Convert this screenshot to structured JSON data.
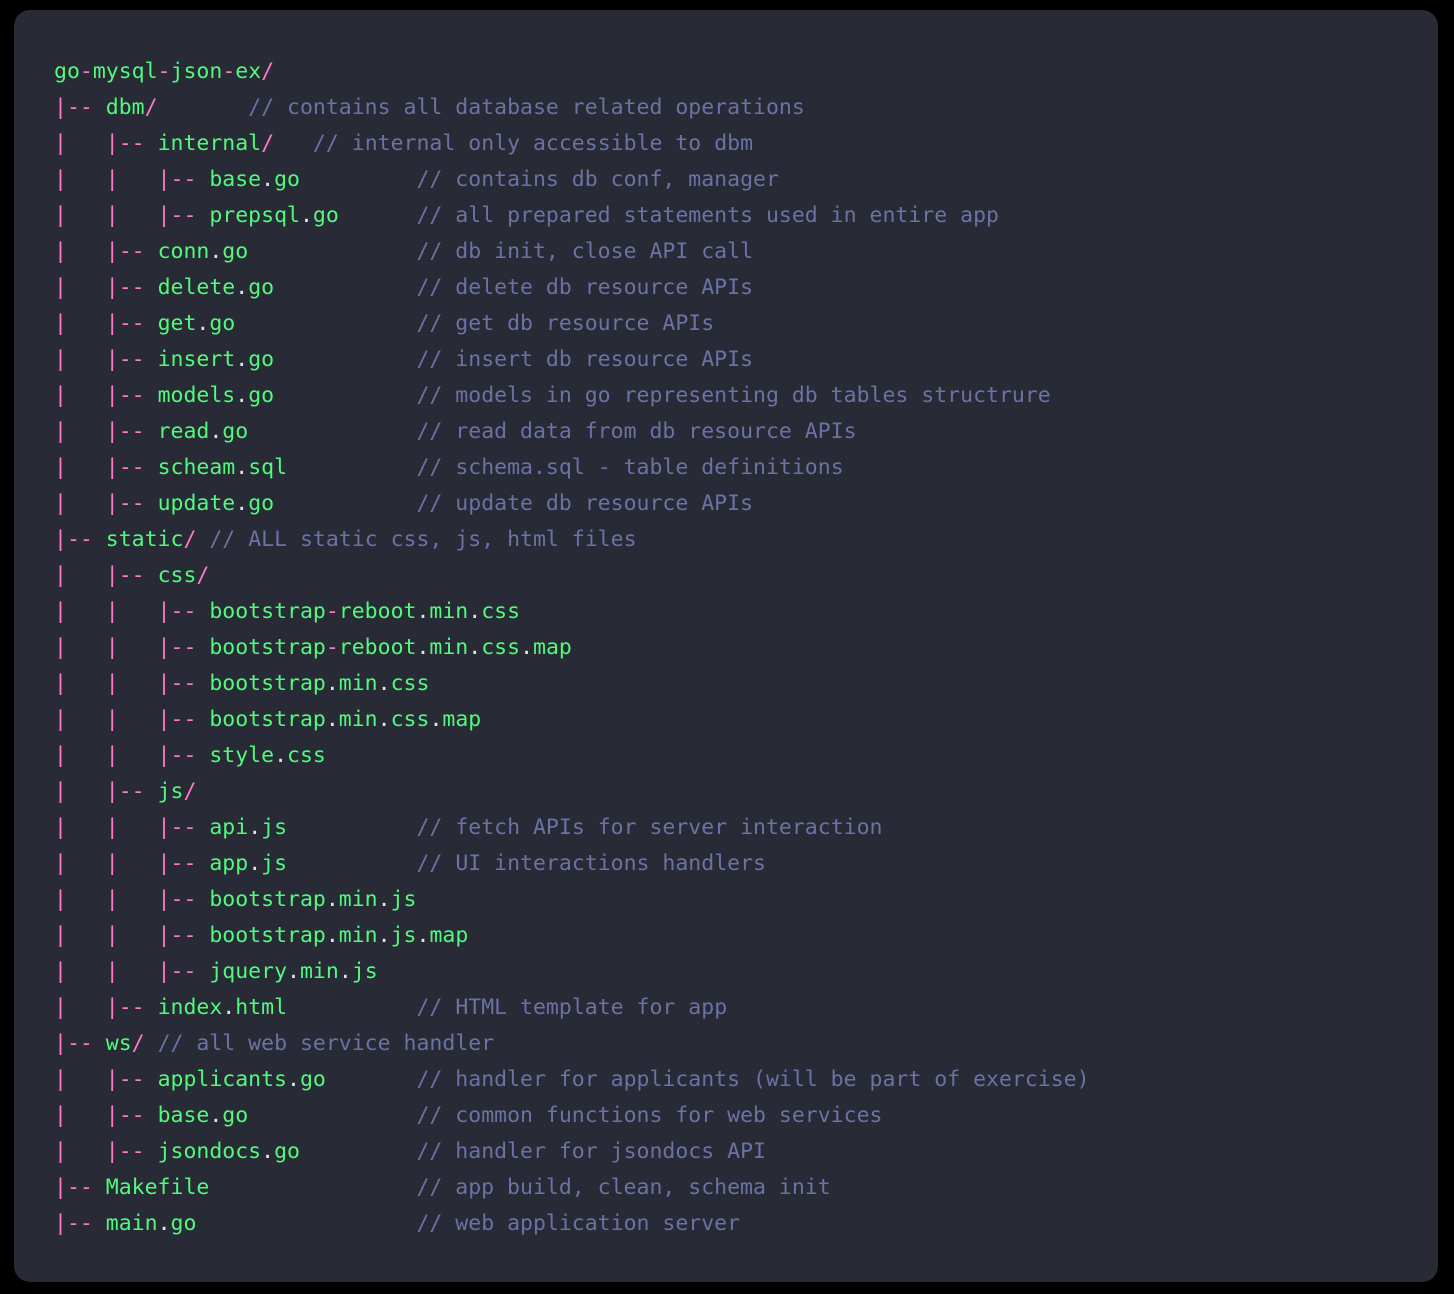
{
  "theme": {
    "outer_background": "#000000",
    "panel_background": "#282a36",
    "tree_color": "#ff79c6",
    "name_color": "#50fa7b",
    "dot_color": "#e2e2ea",
    "comment_color": "#6b72a4"
  },
  "tree": {
    "root": "go-mysql-json-ex/",
    "lines": [
      {
        "prefix": "",
        "name": "go-mysql-json-ex/",
        "pad": 0,
        "comment": ""
      },
      {
        "prefix": "|-- ",
        "name": "dbm/",
        "pad": 7,
        "comment": "// contains all database related operations"
      },
      {
        "prefix": "|   |-- ",
        "name": "internal/",
        "pad": 3,
        "comment": "// internal only accessible to dbm"
      },
      {
        "prefix": "|   |   |-- ",
        "name": "base.go",
        "pad": 9,
        "comment": "// contains db conf, manager"
      },
      {
        "prefix": "|   |   |-- ",
        "name": "prepsql.go",
        "pad": 6,
        "comment": "// all prepared statements used in entire app"
      },
      {
        "prefix": "|   |-- ",
        "name": "conn.go",
        "pad": 13,
        "comment": "// db init, close API call"
      },
      {
        "prefix": "|   |-- ",
        "name": "delete.go",
        "pad": 11,
        "comment": "// delete db resource APIs"
      },
      {
        "prefix": "|   |-- ",
        "name": "get.go",
        "pad": 14,
        "comment": "// get db resource APIs"
      },
      {
        "prefix": "|   |-- ",
        "name": "insert.go",
        "pad": 11,
        "comment": "// insert db resource APIs"
      },
      {
        "prefix": "|   |-- ",
        "name": "models.go",
        "pad": 11,
        "comment": "// models in go representing db tables structrure"
      },
      {
        "prefix": "|   |-- ",
        "name": "read.go",
        "pad": 13,
        "comment": "// read data from db resource APIs"
      },
      {
        "prefix": "|   |-- ",
        "name": "scheam.sql",
        "pad": 10,
        "comment": "// schema.sql - table definitions"
      },
      {
        "prefix": "|   |-- ",
        "name": "update.go",
        "pad": 11,
        "comment": "// update db resource APIs"
      },
      {
        "prefix": "|-- ",
        "name": "static/",
        "pad": 1,
        "comment": "// ALL static css, js, html files"
      },
      {
        "prefix": "|   |-- ",
        "name": "css/",
        "pad": 0,
        "comment": ""
      },
      {
        "prefix": "|   |   |-- ",
        "name": "bootstrap-reboot.min.css",
        "pad": 0,
        "comment": ""
      },
      {
        "prefix": "|   |   |-- ",
        "name": "bootstrap-reboot.min.css.map",
        "pad": 0,
        "comment": ""
      },
      {
        "prefix": "|   |   |-- ",
        "name": "bootstrap.min.css",
        "pad": 0,
        "comment": ""
      },
      {
        "prefix": "|   |   |-- ",
        "name": "bootstrap.min.css.map",
        "pad": 0,
        "comment": ""
      },
      {
        "prefix": "|   |   |-- ",
        "name": "style.css",
        "pad": 0,
        "comment": ""
      },
      {
        "prefix": "|   |-- ",
        "name": "js/",
        "pad": 0,
        "comment": ""
      },
      {
        "prefix": "|   |   |-- ",
        "name": "api.js",
        "pad": 10,
        "comment": "// fetch APIs for server interaction"
      },
      {
        "prefix": "|   |   |-- ",
        "name": "app.js",
        "pad": 10,
        "comment": "// UI interactions handlers"
      },
      {
        "prefix": "|   |   |-- ",
        "name": "bootstrap.min.js",
        "pad": 0,
        "comment": ""
      },
      {
        "prefix": "|   |   |-- ",
        "name": "bootstrap.min.js.map",
        "pad": 0,
        "comment": ""
      },
      {
        "prefix": "|   |   |-- ",
        "name": "jquery.min.js",
        "pad": 0,
        "comment": ""
      },
      {
        "prefix": "|   |-- ",
        "name": "index.html",
        "pad": 10,
        "comment": "// HTML template for app"
      },
      {
        "prefix": "|-- ",
        "name": "ws/",
        "pad": 1,
        "comment": "// all web service handler"
      },
      {
        "prefix": "|   |-- ",
        "name": "applicants.go",
        "pad": 7,
        "comment": "// handler for applicants (will be part of exercise)"
      },
      {
        "prefix": "|   |-- ",
        "name": "base.go",
        "pad": 13,
        "comment": "// common functions for web services"
      },
      {
        "prefix": "|   |-- ",
        "name": "jsondocs.go",
        "pad": 9,
        "comment": "// handler for jsondocs API"
      },
      {
        "prefix": "|-- ",
        "name": "Makefile",
        "pad": 16,
        "comment": "// app build, clean, schema init"
      },
      {
        "prefix": "|-- ",
        "name": "main.go",
        "pad": 17,
        "comment": "// web application server"
      }
    ]
  }
}
